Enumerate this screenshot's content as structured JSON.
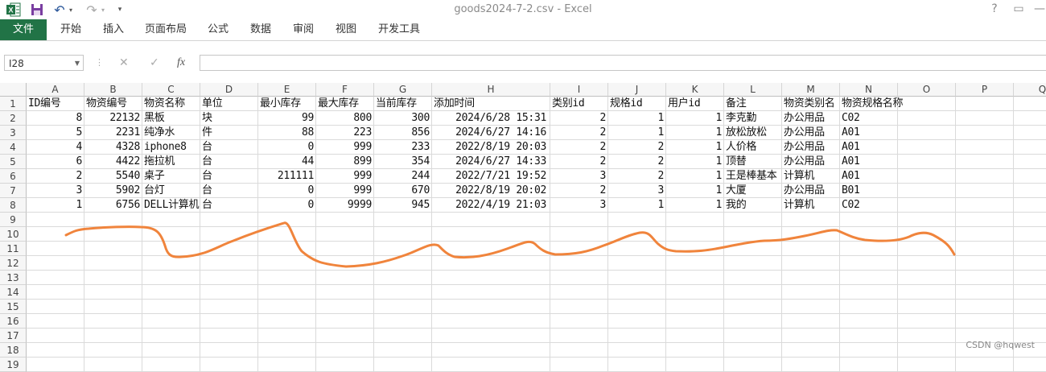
{
  "window": {
    "title": "goods2024-7-2.csv - Excel"
  },
  "quick_access": {
    "undo_glyph": "↶",
    "redo_glyph": "↷",
    "more_glyph": "▾"
  },
  "window_controls": {
    "help": "?",
    "restore": "▭",
    "minimize": "—"
  },
  "ribbon": {
    "tabs": [
      "文件",
      "开始",
      "插入",
      "页面布局",
      "公式",
      "数据",
      "审阅",
      "视图",
      "开发工具"
    ]
  },
  "formula_bar": {
    "name_box": "I28",
    "fx_label": "fx",
    "cancel": "✕",
    "enter": "✓",
    "value": ""
  },
  "colors": {
    "excel_green": "#217346",
    "annotation_line": "#f0843c"
  },
  "columns": [
    "A",
    "B",
    "C",
    "D",
    "E",
    "F",
    "G",
    "H",
    "I",
    "J",
    "K",
    "L",
    "M",
    "N",
    "O",
    "P",
    "Q"
  ],
  "rows": [
    "1",
    "2",
    "3",
    "4",
    "5",
    "6",
    "7",
    "8",
    "9",
    "10",
    "11",
    "12",
    "13",
    "14",
    "15",
    "16",
    "17",
    "18",
    "19"
  ],
  "sheet": {
    "headers": [
      "ID编号",
      "物资编号",
      "物资名称",
      "单位",
      "最小库存",
      "最大库存",
      "当前库存",
      "添加时间",
      "类别id",
      "规格id",
      "用户id",
      "备注",
      "物资类别名",
      "物资规格名称"
    ],
    "data": [
      [
        "8",
        "22132",
        "黑板",
        "块",
        "99",
        "800",
        "300",
        "2024/6/28 15:31",
        "2",
        "1",
        "1",
        "李克勤",
        "办公用品",
        "C02"
      ],
      [
        "5",
        "2231",
        "纯净水",
        "件",
        "88",
        "223",
        "856",
        "2024/6/27 14:16",
        "2",
        "1",
        "1",
        "放松放松",
        "办公用品",
        "A01"
      ],
      [
        "4",
        "4328",
        "iphone8",
        "台",
        "0",
        "999",
        "233",
        "2022/8/19 20:03",
        "2",
        "2",
        "1",
        "人价格",
        "办公用品",
        "A01"
      ],
      [
        "6",
        "4422",
        "拖拉机",
        "台",
        "44",
        "899",
        "354",
        "2024/6/27 14:33",
        "2",
        "2",
        "1",
        "顶替",
        "办公用品",
        "A01"
      ],
      [
        "2",
        "5540",
        "桌子",
        "台",
        "211111",
        "999",
        "244",
        "2022/7/21 19:52",
        "3",
        "2",
        "1",
        "王是棒基本",
        "计算机",
        "A01"
      ],
      [
        "3",
        "5902",
        "台灯",
        "台",
        "0",
        "999",
        "670",
        "2022/8/19 20:02",
        "2",
        "3",
        "1",
        "大厦",
        "办公用品",
        "B01"
      ],
      [
        "1",
        "6756",
        "DELL计算机",
        "台",
        "0",
        "9999",
        "945",
        "2022/4/19 21:03",
        "3",
        "1",
        "1",
        "我的",
        "计算机",
        "C02"
      ]
    ]
  },
  "watermark": "CSDN @hqwest"
}
